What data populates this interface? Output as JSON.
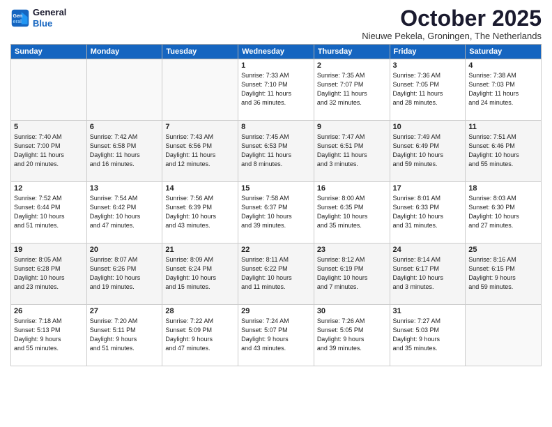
{
  "logo": {
    "line1": "General",
    "line2": "Blue"
  },
  "title": "October 2025",
  "subtitle": "Nieuwe Pekela, Groningen, The Netherlands",
  "days_header": [
    "Sunday",
    "Monday",
    "Tuesday",
    "Wednesday",
    "Thursday",
    "Friday",
    "Saturday"
  ],
  "weeks": [
    [
      {
        "day": "",
        "info": ""
      },
      {
        "day": "",
        "info": ""
      },
      {
        "day": "",
        "info": ""
      },
      {
        "day": "1",
        "info": "Sunrise: 7:33 AM\nSunset: 7:10 PM\nDaylight: 11 hours\nand 36 minutes."
      },
      {
        "day": "2",
        "info": "Sunrise: 7:35 AM\nSunset: 7:07 PM\nDaylight: 11 hours\nand 32 minutes."
      },
      {
        "day": "3",
        "info": "Sunrise: 7:36 AM\nSunset: 7:05 PM\nDaylight: 11 hours\nand 28 minutes."
      },
      {
        "day": "4",
        "info": "Sunrise: 7:38 AM\nSunset: 7:03 PM\nDaylight: 11 hours\nand 24 minutes."
      }
    ],
    [
      {
        "day": "5",
        "info": "Sunrise: 7:40 AM\nSunset: 7:00 PM\nDaylight: 11 hours\nand 20 minutes."
      },
      {
        "day": "6",
        "info": "Sunrise: 7:42 AM\nSunset: 6:58 PM\nDaylight: 11 hours\nand 16 minutes."
      },
      {
        "day": "7",
        "info": "Sunrise: 7:43 AM\nSunset: 6:56 PM\nDaylight: 11 hours\nand 12 minutes."
      },
      {
        "day": "8",
        "info": "Sunrise: 7:45 AM\nSunset: 6:53 PM\nDaylight: 11 hours\nand 8 minutes."
      },
      {
        "day": "9",
        "info": "Sunrise: 7:47 AM\nSunset: 6:51 PM\nDaylight: 11 hours\nand 3 minutes."
      },
      {
        "day": "10",
        "info": "Sunrise: 7:49 AM\nSunset: 6:49 PM\nDaylight: 10 hours\nand 59 minutes."
      },
      {
        "day": "11",
        "info": "Sunrise: 7:51 AM\nSunset: 6:46 PM\nDaylight: 10 hours\nand 55 minutes."
      }
    ],
    [
      {
        "day": "12",
        "info": "Sunrise: 7:52 AM\nSunset: 6:44 PM\nDaylight: 10 hours\nand 51 minutes."
      },
      {
        "day": "13",
        "info": "Sunrise: 7:54 AM\nSunset: 6:42 PM\nDaylight: 10 hours\nand 47 minutes."
      },
      {
        "day": "14",
        "info": "Sunrise: 7:56 AM\nSunset: 6:39 PM\nDaylight: 10 hours\nand 43 minutes."
      },
      {
        "day": "15",
        "info": "Sunrise: 7:58 AM\nSunset: 6:37 PM\nDaylight: 10 hours\nand 39 minutes."
      },
      {
        "day": "16",
        "info": "Sunrise: 8:00 AM\nSunset: 6:35 PM\nDaylight: 10 hours\nand 35 minutes."
      },
      {
        "day": "17",
        "info": "Sunrise: 8:01 AM\nSunset: 6:33 PM\nDaylight: 10 hours\nand 31 minutes."
      },
      {
        "day": "18",
        "info": "Sunrise: 8:03 AM\nSunset: 6:30 PM\nDaylight: 10 hours\nand 27 minutes."
      }
    ],
    [
      {
        "day": "19",
        "info": "Sunrise: 8:05 AM\nSunset: 6:28 PM\nDaylight: 10 hours\nand 23 minutes."
      },
      {
        "day": "20",
        "info": "Sunrise: 8:07 AM\nSunset: 6:26 PM\nDaylight: 10 hours\nand 19 minutes."
      },
      {
        "day": "21",
        "info": "Sunrise: 8:09 AM\nSunset: 6:24 PM\nDaylight: 10 hours\nand 15 minutes."
      },
      {
        "day": "22",
        "info": "Sunrise: 8:11 AM\nSunset: 6:22 PM\nDaylight: 10 hours\nand 11 minutes."
      },
      {
        "day": "23",
        "info": "Sunrise: 8:12 AM\nSunset: 6:19 PM\nDaylight: 10 hours\nand 7 minutes."
      },
      {
        "day": "24",
        "info": "Sunrise: 8:14 AM\nSunset: 6:17 PM\nDaylight: 10 hours\nand 3 minutes."
      },
      {
        "day": "25",
        "info": "Sunrise: 8:16 AM\nSunset: 6:15 PM\nDaylight: 9 hours\nand 59 minutes."
      }
    ],
    [
      {
        "day": "26",
        "info": "Sunrise: 7:18 AM\nSunset: 5:13 PM\nDaylight: 9 hours\nand 55 minutes."
      },
      {
        "day": "27",
        "info": "Sunrise: 7:20 AM\nSunset: 5:11 PM\nDaylight: 9 hours\nand 51 minutes."
      },
      {
        "day": "28",
        "info": "Sunrise: 7:22 AM\nSunset: 5:09 PM\nDaylight: 9 hours\nand 47 minutes."
      },
      {
        "day": "29",
        "info": "Sunrise: 7:24 AM\nSunset: 5:07 PM\nDaylight: 9 hours\nand 43 minutes."
      },
      {
        "day": "30",
        "info": "Sunrise: 7:26 AM\nSunset: 5:05 PM\nDaylight: 9 hours\nand 39 minutes."
      },
      {
        "day": "31",
        "info": "Sunrise: 7:27 AM\nSunset: 5:03 PM\nDaylight: 9 hours\nand 35 minutes."
      },
      {
        "day": "",
        "info": ""
      }
    ]
  ]
}
